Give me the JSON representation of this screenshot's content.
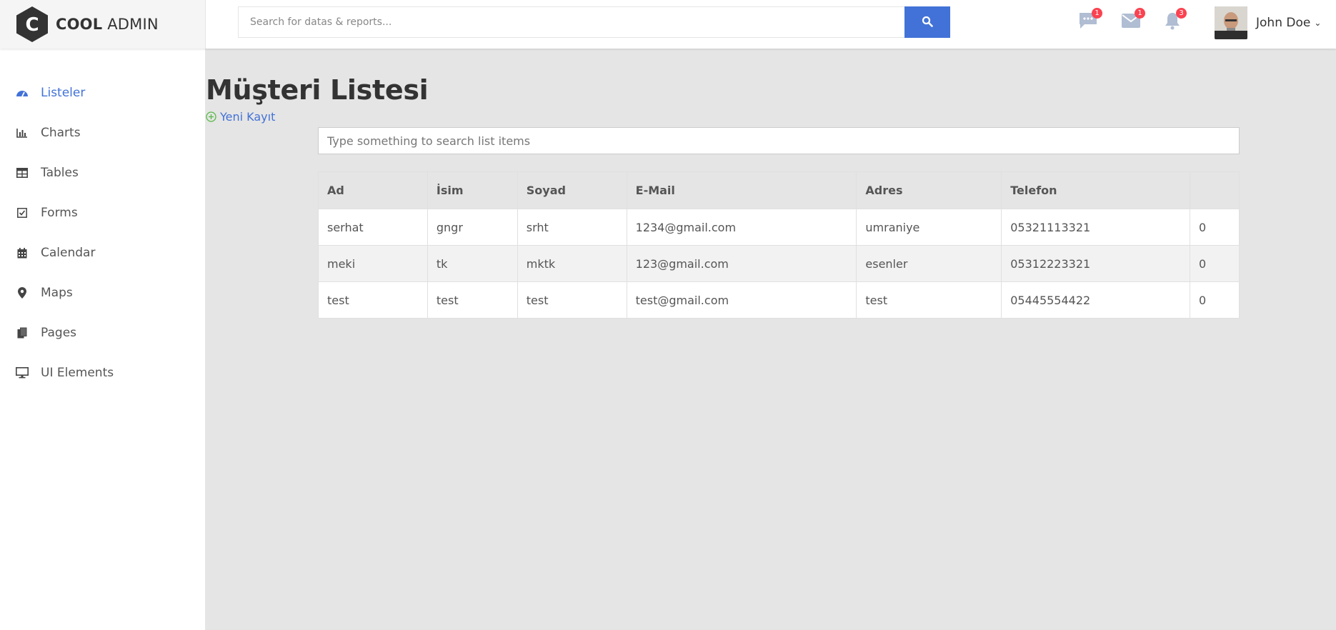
{
  "brand": {
    "bold": "COOL",
    "rest": "ADMIN",
    "initial": "C"
  },
  "header": {
    "search_placeholder": "Search for datas & reports...",
    "notifications": [
      {
        "icon": "chat-icon",
        "count": "1"
      },
      {
        "icon": "mail-icon",
        "count": "1"
      },
      {
        "icon": "bell-icon",
        "count": "3"
      }
    ],
    "user_name": "John Doe"
  },
  "sidebar": {
    "items": [
      {
        "label": "Listeler",
        "icon": "dashboard-icon",
        "active": true
      },
      {
        "label": "Charts",
        "icon": "bar-chart-icon"
      },
      {
        "label": "Tables",
        "icon": "table-icon"
      },
      {
        "label": "Forms",
        "icon": "checkbox-icon"
      },
      {
        "label": "Calendar",
        "icon": "calendar-icon"
      },
      {
        "label": "Maps",
        "icon": "map-marker-icon"
      },
      {
        "label": "Pages",
        "icon": "pages-icon"
      },
      {
        "label": "UI Elements",
        "icon": "desktop-icon"
      }
    ]
  },
  "main": {
    "title": "Müşteri Listesi",
    "new_link": "Yeni Kayıt",
    "list_search_placeholder": "Type something to search list items",
    "columns": [
      "Ad",
      "İsim",
      "Soyad",
      "E-Mail",
      "Adres",
      "Telefon",
      ""
    ],
    "rows": [
      [
        "serhat",
        "gngr",
        "srht",
        "1234@gmail.com",
        "umraniye",
        "05321113321",
        "0"
      ],
      [
        "meki",
        "tk",
        "mktk",
        "123@gmail.com",
        "esenler",
        "05312223321",
        "0"
      ],
      [
        "test",
        "test",
        "test",
        "test@gmail.com",
        "test",
        "05445554422",
        "0"
      ]
    ]
  },
  "colors": {
    "accent": "#4272d7",
    "badge": "#fa4251",
    "icon_gray": "#b0bdd3",
    "plus_green": "#57b846"
  }
}
